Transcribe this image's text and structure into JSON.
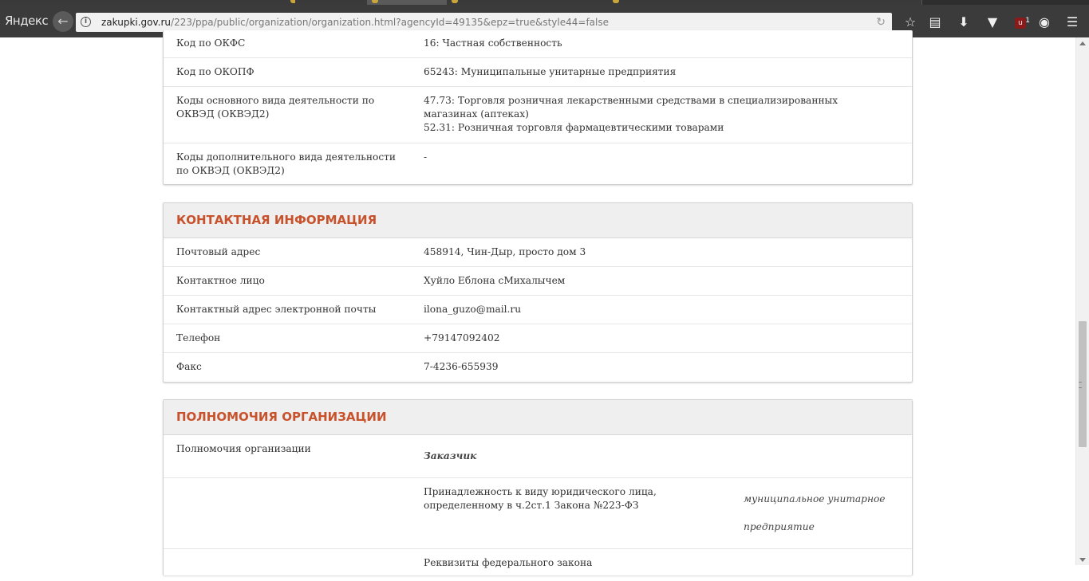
{
  "browser": {
    "brand": "Яндекс",
    "url_host": "zakupki.gov.ru",
    "url_path": "/223/ppa/public/organization/organization.html?agencyId=49135&epz=true&style44=false",
    "ublock_badge": "1"
  },
  "codes": {
    "rows": [
      {
        "label": "Код по ОКФС",
        "value": "16: Частная собственность"
      },
      {
        "label": "Код по ОКОПФ",
        "value": "65243: Муниципальные унитарные предприятия"
      },
      {
        "label": "Коды основного вида деятельности по ОКВЭД (ОКВЭД2)",
        "value_lines": [
          "47.73: Торговля розничная лекарственными средствами в специализированных магазинах (аптеках)",
          "52.31: Розничная торговля фармацевтическими товарами"
        ]
      },
      {
        "label": "Коды дополнительного вида деятельности по ОКВЭД (ОКВЭД2)",
        "value": "-"
      }
    ]
  },
  "contact": {
    "title": "КОНТАКТНАЯ ИНФОРМАЦИЯ",
    "rows": [
      {
        "label": "Почтовый адрес",
        "value": "458914, Чин-Дыр, просто дом 3"
      },
      {
        "label": "Контактное лицо",
        "value": "Хуйло Еблона сМихалычем"
      },
      {
        "label": "Контактный адрес электронной почты",
        "value": "ilona_guzo@mail.ru"
      },
      {
        "label": "Телефон",
        "value": "+79147092402"
      },
      {
        "label": "Факс",
        "value": "7-4236-655939"
      }
    ]
  },
  "powers": {
    "title": "ПОЛНОМОЧИЯ ОРГАНИЗАЦИИ",
    "label": "Полномочия организации",
    "role": "Заказчик",
    "affiliation_label": "Принадлежность к виду юридического лица, определенному в ч.2ст.1 Закона №223-ФЗ",
    "affiliation_value_line1": "муниципальное унитарное",
    "affiliation_value_line2": "предприятие",
    "next_label": "Реквизиты федерального закона"
  }
}
